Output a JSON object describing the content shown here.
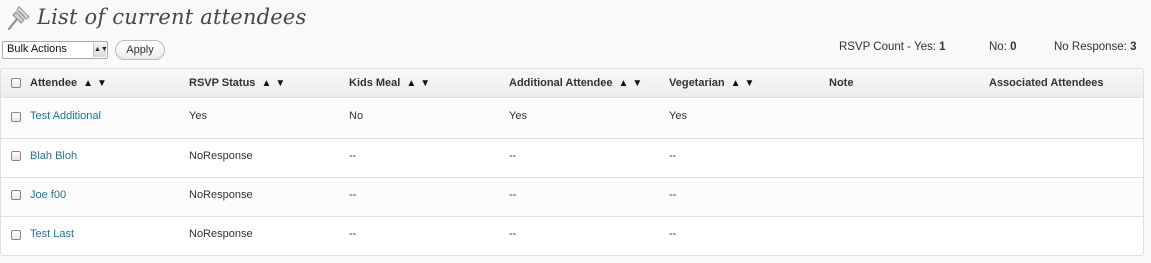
{
  "page": {
    "title": "List of current attendees"
  },
  "toolbar": {
    "bulk_actions": "Bulk Actions",
    "apply": "Apply",
    "rsvp_yes_label": "RSVP Count - Yes:",
    "rsvp_yes": "1",
    "rsvp_no_label": "No:",
    "rsvp_no": "0",
    "rsvp_noresp_label": "No Response:",
    "rsvp_noresp": "3"
  },
  "table": {
    "headers": {
      "attendee": "Attendee",
      "rsvp_status": "RSVP Status",
      "kids_meal": "Kids Meal",
      "additional_attendee": "Additional Attendee",
      "vegetarian": "Vegetarian",
      "note": "Note",
      "associated_attendees": "Associated Attendees"
    },
    "sort_glyph": "▲▼",
    "rows": [
      {
        "attendee": "Test Additional",
        "rsvp_status": "Yes",
        "kids_meal": "No",
        "additional_attendee": "Yes",
        "vegetarian": "Yes",
        "note": "",
        "associated": ""
      },
      {
        "attendee": "Blah Bloh",
        "rsvp_status": "NoResponse",
        "kids_meal": "--",
        "additional_attendee": "--",
        "vegetarian": "--",
        "note": "",
        "associated": ""
      },
      {
        "attendee": "Joe f00",
        "rsvp_status": "NoResponse",
        "kids_meal": "--",
        "additional_attendee": "--",
        "vegetarian": "--",
        "note": "",
        "associated": ""
      },
      {
        "attendee": "Test Last",
        "rsvp_status": "NoResponse",
        "kids_meal": "--",
        "additional_attendee": "--",
        "vegetarian": "--",
        "note": "",
        "associated": ""
      }
    ]
  },
  "colors": {
    "link": "#21759b",
    "border": "#dfdfdf",
    "header_bg": "#ececec"
  }
}
